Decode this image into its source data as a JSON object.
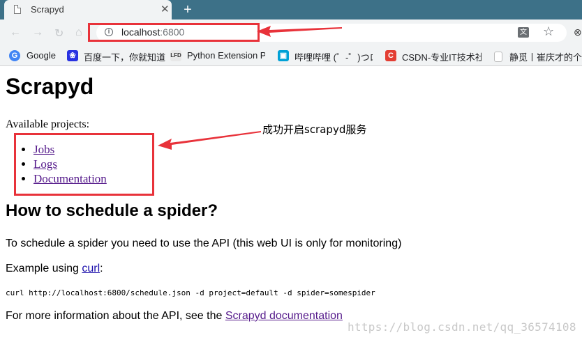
{
  "browser": {
    "tab_title": "Scrapyd",
    "tab_close": "✕",
    "new_tab": "+",
    "url_host": "localhost",
    "url_port": ":6800",
    "translate_glyph": "文",
    "star_glyph": "☆"
  },
  "bookmarks": [
    {
      "label": "Google",
      "icon": "google-icon",
      "color": "#4285f4"
    },
    {
      "label": "百度一下，你就知道",
      "icon": "baidu-icon",
      "color": "#2932e1"
    },
    {
      "label": "Python Extension P",
      "icon": "lfd-icon",
      "color": "#333333"
    },
    {
      "label": "哔哩哔哩 (゜-゜)つロ",
      "icon": "bilibili-icon",
      "color": "#00a1d6"
    },
    {
      "label": "CSDN-专业IT技术社",
      "icon": "csdn-icon",
      "color": "#e33e33"
    },
    {
      "label": "静觅丨崔庆才的个人",
      "icon": "page-icon",
      "color": "#ffffff"
    }
  ],
  "page": {
    "title": "Scrapyd",
    "available_label": "Available projects:",
    "links": [
      "Jobs",
      "Logs",
      "Documentation"
    ],
    "heading": "How to schedule a spider?",
    "para1": "To schedule a spider you need to use the API (this web UI is only for monitoring)",
    "example_prefix": "Example using ",
    "example_link": "curl",
    "example_suffix": ":",
    "curl_command": "curl http://localhost:6800/schedule.json -d project=default -d spider=somespider",
    "more_prefix": "For more information about the API, see the ",
    "more_link": "Scrapyd documentation"
  },
  "annotation": {
    "note": "成功开启scrapyd服务",
    "color": "#e8323a"
  },
  "watermark": "https://blog.csdn.net/qq_36574108"
}
